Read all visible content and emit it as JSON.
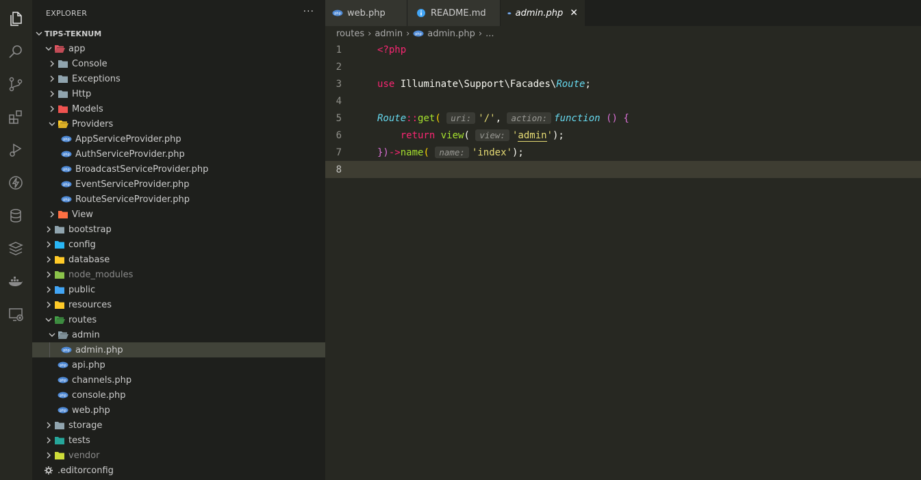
{
  "activity_bar": {
    "icons": [
      "files-icon",
      "search-icon",
      "source-control-icon",
      "extensions-icon",
      "run-debug-icon",
      "lightning-icon",
      "database-icon",
      "layers-icon",
      "docker-icon",
      "remote-explorer-icon"
    ]
  },
  "explorer": {
    "title": "EXPLORER",
    "more": "···",
    "root": "TIPS-TEKNUM",
    "items": [
      {
        "label": "app",
        "depth": 1,
        "kind": "folder",
        "open": true,
        "color": "#e05561",
        "name": "app"
      },
      {
        "label": "Console",
        "depth": 2,
        "kind": "folder",
        "open": false,
        "color": "#90a4ae",
        "name": "console"
      },
      {
        "label": "Exceptions",
        "depth": 2,
        "kind": "folder",
        "open": false,
        "color": "#90a4ae",
        "name": "exceptions"
      },
      {
        "label": "Http",
        "depth": 2,
        "kind": "folder",
        "open": false,
        "color": "#90a4ae",
        "name": "http"
      },
      {
        "label": "Models",
        "depth": 2,
        "kind": "folder",
        "open": false,
        "color": "#ef5350",
        "name": "models"
      },
      {
        "label": "Providers",
        "depth": 2,
        "kind": "folder",
        "open": true,
        "color": "#ffca28",
        "name": "providers"
      },
      {
        "label": "AppServiceProvider.php",
        "depth": 3,
        "kind": "php",
        "name": "appserviceprovider"
      },
      {
        "label": "AuthServiceProvider.php",
        "depth": 3,
        "kind": "php",
        "name": "authserviceprovider"
      },
      {
        "label": "BroadcastServiceProvider.php",
        "depth": 3,
        "kind": "php",
        "name": "broadcastserviceprovider"
      },
      {
        "label": "EventServiceProvider.php",
        "depth": 3,
        "kind": "php",
        "name": "eventserviceprovider"
      },
      {
        "label": "RouteServiceProvider.php",
        "depth": 3,
        "kind": "php",
        "name": "routeserviceprovider"
      },
      {
        "label": "View",
        "depth": 2,
        "kind": "folder",
        "open": false,
        "color": "#ff7043",
        "name": "view"
      },
      {
        "label": "bootstrap",
        "depth": 1,
        "kind": "folder",
        "open": false,
        "color": "#90a4ae",
        "name": "bootstrap"
      },
      {
        "label": "config",
        "depth": 1,
        "kind": "folder",
        "open": false,
        "color": "#29b6f6",
        "name": "config"
      },
      {
        "label": "database",
        "depth": 1,
        "kind": "folder",
        "open": false,
        "color": "#ffca28",
        "name": "database"
      },
      {
        "label": "node_modules",
        "depth": 1,
        "kind": "folder",
        "open": false,
        "color": "#8bc34a",
        "dim": true,
        "name": "node-modules"
      },
      {
        "label": "public",
        "depth": 1,
        "kind": "folder",
        "open": false,
        "color": "#42a5f5",
        "name": "public"
      },
      {
        "label": "resources",
        "depth": 1,
        "kind": "folder",
        "open": false,
        "color": "#ffca28",
        "name": "resources"
      },
      {
        "label": "routes",
        "depth": 1,
        "kind": "folder",
        "open": true,
        "color": "#43a047",
        "name": "routes"
      },
      {
        "label": "admin",
        "depth": 2,
        "kind": "folder",
        "open": true,
        "color": "#90a4ae",
        "name": "admin"
      },
      {
        "label": "admin.php",
        "depth": 3,
        "kind": "php",
        "selected": true,
        "name": "admin-php"
      },
      {
        "label": "api.php",
        "depth": 2,
        "kind": "php",
        "name": "api-php"
      },
      {
        "label": "channels.php",
        "depth": 2,
        "kind": "php",
        "name": "channels-php"
      },
      {
        "label": "console.php",
        "depth": 2,
        "kind": "php",
        "name": "console-php"
      },
      {
        "label": "web.php",
        "depth": 2,
        "kind": "php",
        "name": "web-php"
      },
      {
        "label": "storage",
        "depth": 1,
        "kind": "folder",
        "open": false,
        "color": "#90a4ae",
        "name": "storage"
      },
      {
        "label": "tests",
        "depth": 1,
        "kind": "folder",
        "open": false,
        "color": "#26a69a",
        "name": "tests"
      },
      {
        "label": "vendor",
        "depth": 1,
        "kind": "folder",
        "open": false,
        "color": "#cddc39",
        "dim": true,
        "name": "vendor"
      },
      {
        "label": ".editorconfig",
        "depth": 1,
        "kind": "gear",
        "name": "editorconfig"
      }
    ]
  },
  "tabs": [
    {
      "label": "web.php",
      "icon": "php",
      "state": "inactive"
    },
    {
      "label": "README.md",
      "icon": "info",
      "state": "inactive"
    },
    {
      "label": "admin.php",
      "icon": "php",
      "state": "active",
      "close": "✕"
    }
  ],
  "breadcrumb": [
    "routes",
    "admin",
    "admin.php",
    "..."
  ],
  "code": {
    "line_numbers": [
      "1",
      "2",
      "3",
      "4",
      "5",
      "6",
      "7",
      "8"
    ],
    "current_line": 8,
    "l1_open": "<?php",
    "l3_use": "use",
    "l3_ns": "Illuminate\\Support\\Facades\\",
    "l3_class": "Route",
    "l3_semi": ";",
    "l5_class": "Route",
    "l5_dcolon": "::",
    "l5_fn": "get",
    "l5_paren": "(",
    "l5_hint1": "uri:",
    "l5_str": "'/'",
    "l5_comma": ",",
    "l5_hint2": "action:",
    "l5_function": "function",
    "l5_parens": "()",
    "l5_brace": "{",
    "l6_return": "return",
    "l6_fn": "view",
    "l6_paren": "(",
    "l6_hint": "view:",
    "l6_q1": "'",
    "l6_str": "admin",
    "l6_q2": "'",
    "l6_close": ");",
    "l7_close": "})",
    "l7_arrow": "->",
    "l7_fn": "name",
    "l7_paren": "(",
    "l7_hint": "name:",
    "l7_str": "'index'",
    "l7_end": ");"
  }
}
